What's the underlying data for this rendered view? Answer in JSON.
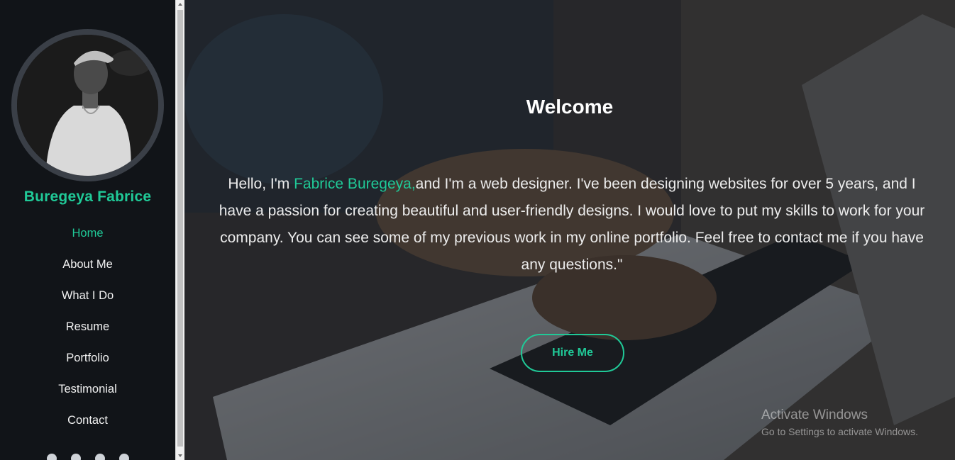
{
  "sidebar": {
    "name": "Buregeya Fabrice",
    "nav": [
      {
        "label": "Home",
        "active": true
      },
      {
        "label": "About Me",
        "active": false
      },
      {
        "label": "What I Do",
        "active": false
      },
      {
        "label": "Resume",
        "active": false
      },
      {
        "label": "Portfolio",
        "active": false
      },
      {
        "label": "Testimonial",
        "active": false
      },
      {
        "label": "Contact",
        "active": false
      }
    ],
    "socials": [
      "facebook-icon",
      "twitter-icon",
      "instagram-icon",
      "github-icon"
    ]
  },
  "hero": {
    "title": "Welcome",
    "intro_prefix": "Hello, I'm ",
    "intro_name": "Fabrice Buregeya,",
    "intro_rest": "and I'm a web designer. I've been designing websites for over 5 years, and I have a passion for creating beautiful and user-friendly designs. I would love to put my skills to work for your company. You can see some of my previous work in my online portfolio. Feel free to contact me if you have any questions.\"",
    "cta": "Hire Me"
  },
  "watermark": {
    "title": "Activate Windows",
    "subtitle": "Go to Settings to activate Windows."
  },
  "colors": {
    "accent": "#20c997",
    "sidebar_bg": "#111418"
  }
}
